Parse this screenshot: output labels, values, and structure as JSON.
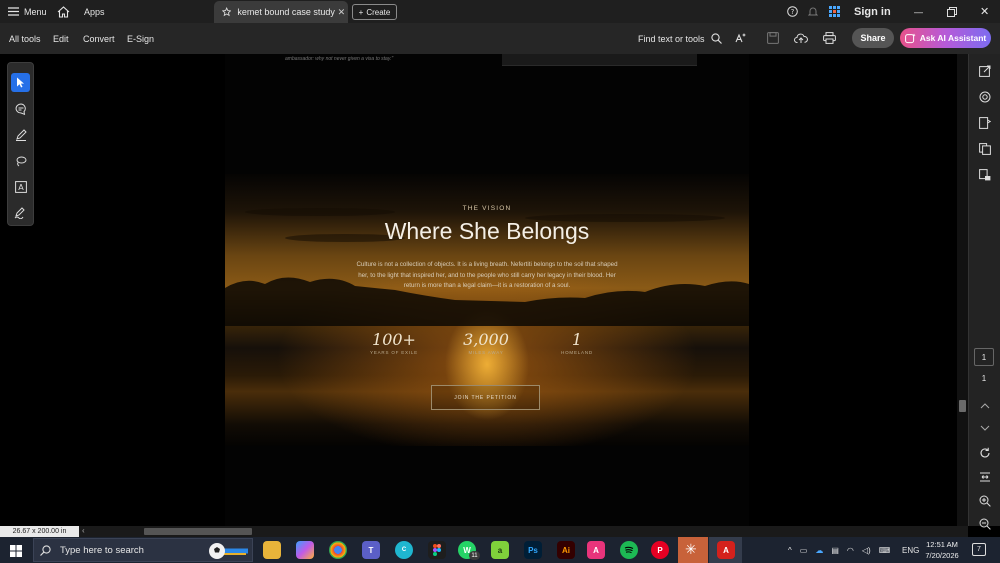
{
  "titlebar": {
    "menu_label": "Menu",
    "apps_label": "Apps",
    "tab_title": "kemet bound case study",
    "create_label": "Create",
    "sign_in_label": "Sign in"
  },
  "toolbar": {
    "menus": [
      "All tools",
      "Edit",
      "Convert",
      "E-Sign"
    ],
    "find_label": "Find text or tools",
    "share_label": "Share",
    "ai_label": "Ask AI Assistant"
  },
  "document": {
    "top_quote": "ambassador: why not never given a visa to stay.\"",
    "eyebrow": "THE VISION",
    "title": "Where She Belongs",
    "body": "Culture is not a collection of objects. It is a living breath. Nefertiti belongs to the soil that shaped her, to the light that inspired her, and to the people who still carry her legacy in their blood. Her return is more than a legal claim—it is a restoration of a soul.",
    "stats": [
      {
        "num": "100+",
        "label": "YEARS OF EXILE"
      },
      {
        "num": "3,000",
        "label": "MILES AWAY"
      },
      {
        "num": "1",
        "label": "HOMELAND"
      }
    ],
    "petition_label": "JOIN THE PETITION"
  },
  "page_nav": {
    "current_page": "1",
    "total_pages": "1"
  },
  "status": {
    "page_size": "26.67 x 200.00 in"
  },
  "taskbar": {
    "search_placeholder": "Type here to search",
    "whatsapp_badge": "11",
    "language": "ENG",
    "time": "12:51 AM",
    "date": "7/20/2026",
    "notification_count": "7"
  },
  "colors": {
    "accent_blue": "#2670e8",
    "ai_gradient_start": "#e8528a",
    "ai_gradient_end": "#7c6cf0",
    "acrobat_red": "#d4211c"
  }
}
